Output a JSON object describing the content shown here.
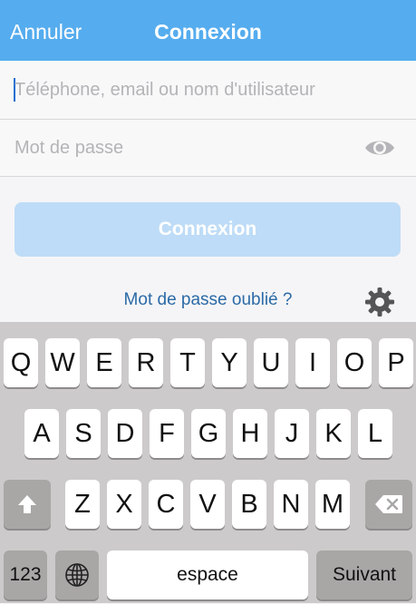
{
  "navbar": {
    "cancel_label": "Annuler",
    "title": "Connexion"
  },
  "form": {
    "username_placeholder": "Téléphone, email ou nom d'utilisateur",
    "password_placeholder": "Mot de passe",
    "login_label": "Connexion",
    "forgot_label": "Mot de passe oublié ?"
  },
  "keyboard": {
    "row1": [
      "Q",
      "W",
      "E",
      "R",
      "T",
      "Y",
      "U",
      "I",
      "O",
      "P"
    ],
    "row2": [
      "A",
      "S",
      "D",
      "F",
      "G",
      "H",
      "J",
      "K",
      "L"
    ],
    "row3": [
      "Z",
      "X",
      "C",
      "V",
      "B",
      "N",
      "M"
    ],
    "numbers_label": "123",
    "space_label": "espace",
    "next_label": "Suivant"
  },
  "icons": {
    "eye": "eye-icon",
    "gear": "gear-icon",
    "shift": "shift-icon",
    "delete": "delete-icon",
    "globe": "globe-icon"
  },
  "colors": {
    "navbar": "#55acee",
    "login_button": "#bedcf7",
    "link": "#2b6aa6",
    "keyboard_bg": "#cdcacb",
    "key": "#ffffff",
    "key_dark": "#a9a6a6"
  }
}
